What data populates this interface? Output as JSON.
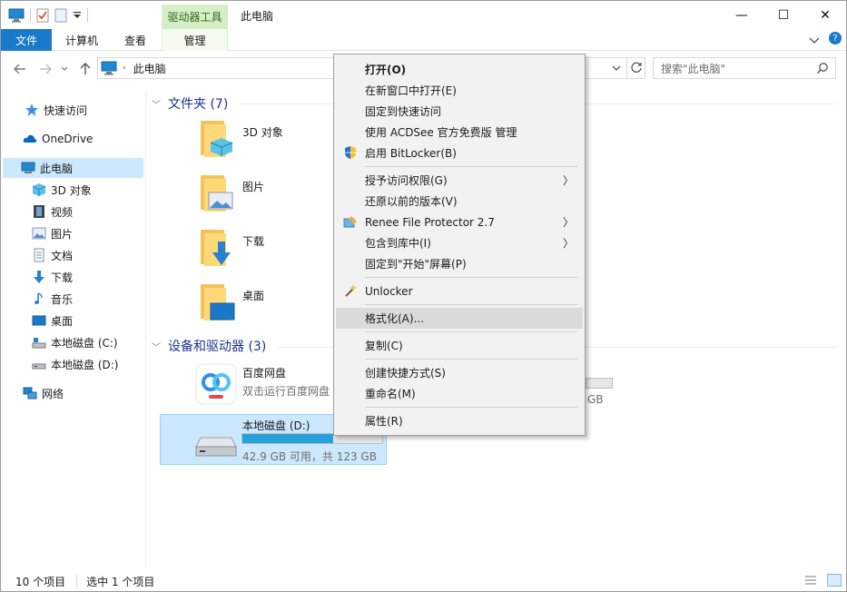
{
  "window": {
    "title": "此电脑",
    "ctx_tab_group": "驱动器工具",
    "minimize": "—",
    "maximize": "☐",
    "close": "✕"
  },
  "ribbon": {
    "tabs": [
      "文件",
      "计算机",
      "查看",
      "管理"
    ],
    "help": "?"
  },
  "address": {
    "path": "此电脑",
    "search_placeholder": "搜索\"此电脑\""
  },
  "sidebar": {
    "quick_access": "快速访问",
    "onedrive": "OneDrive",
    "this_pc": "此电脑",
    "items": [
      "3D 对象",
      "视频",
      "图片",
      "文档",
      "下载",
      "音乐",
      "桌面",
      "本地磁盘 (C:)",
      "本地磁盘 (D:)"
    ],
    "network": "网络"
  },
  "content": {
    "folders_header": "文件夹 (7)",
    "folders": [
      "3D 对象",
      "图片",
      "下载",
      "桌面"
    ],
    "devices_header": "设备和驱动器 (3)",
    "baidu": {
      "name": "百度网盘",
      "desc": "双击运行百度网盘"
    },
    "drive_c_tail": "GB",
    "drive_d": {
      "name": "本地磁盘 (D:)",
      "free": "42.9 GB 可用，共 123 GB",
      "used_fraction": 0.65
    }
  },
  "status": {
    "count": "10 个项目",
    "selected": "选中 1 个项目"
  },
  "menu": {
    "items": [
      "打开(O)",
      "在新窗口中打开(E)",
      "固定到快速访问",
      "使用 ACDSee 官方免费版 管理",
      "启用 BitLocker(B)",
      "授予访问权限(G)",
      "还原以前的版本(V)",
      "Renee File Protector 2.7",
      "包含到库中(I)",
      "固定到\"开始\"屏幕(P)",
      "Unlocker",
      "格式化(A)...",
      "复制(C)",
      "创建快捷方式(S)",
      "重命名(M)",
      "属性(R)"
    ]
  },
  "colors": {
    "accent": "#1979ca",
    "selection": "#cce8ff",
    "context_tab": "#d6eec7",
    "progress": "#26a0da"
  }
}
